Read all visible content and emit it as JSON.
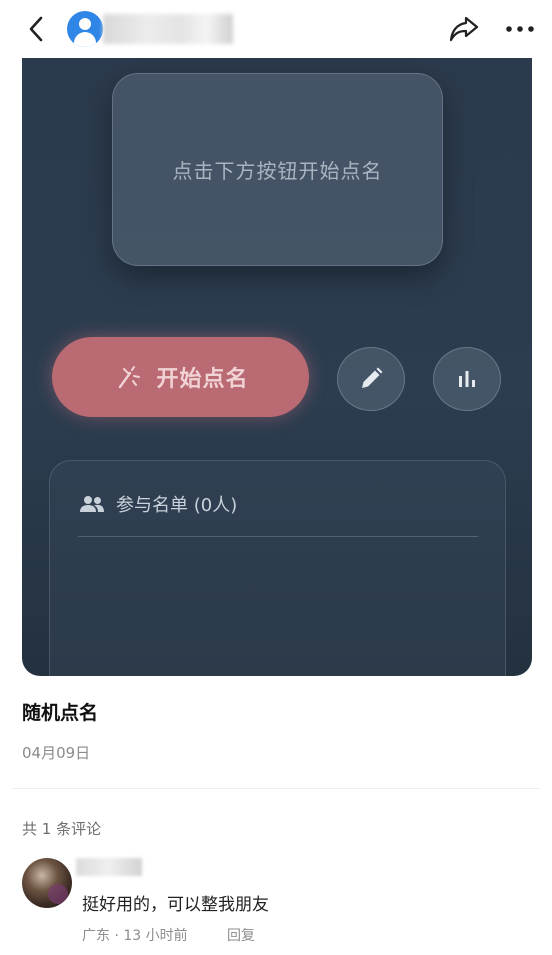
{
  "topbar": {
    "back_icon": "chevron-left-icon",
    "share_icon": "share-icon",
    "more_icon": "more-horizontal-icon"
  },
  "card": {
    "display_prompt": "点击下方按钮开始点名",
    "start_button_label": "开始点名",
    "participants_label": "参与名单 (0人)",
    "colors": {
      "card_bg": "#2b3a4c",
      "start_button": "#b96a72",
      "start_text": "#f1d3d6"
    }
  },
  "post": {
    "title": "随机点名",
    "date": "04月09日"
  },
  "comments": {
    "count_label": "共 1 条评论",
    "items": [
      {
        "text": "挺好用的，可以整我朋友",
        "meta": "广东 · 13 小时前",
        "reply_label": "回复"
      }
    ]
  }
}
